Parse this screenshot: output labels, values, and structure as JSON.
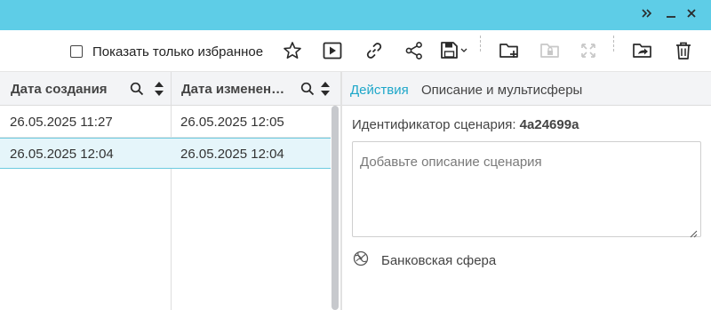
{
  "window": {
    "icons": {
      "collapse": "double-chevron-right-icon",
      "minimize": "minimize-icon",
      "close": "close-icon"
    }
  },
  "toolbar": {
    "favorites_label": "Показать только избранное",
    "favorites_checked": false,
    "icons": [
      "star-icon",
      "play-icon",
      "link-icon",
      "share-icon",
      "save-dropdown-icon",
      "add-folder-icon",
      "lock-folder-icon",
      "expand-icon",
      "open-folder-icon",
      "trash-icon"
    ]
  },
  "grid": {
    "columns": [
      {
        "label": "Дата создания"
      },
      {
        "label": "Дата изменен…"
      }
    ],
    "rows": [
      {
        "created": "26.05.2025 11:27",
        "modified": "26.05.2025 12:05",
        "selected": false
      },
      {
        "created": "26.05.2025 12:04",
        "modified": "26.05.2025 12:04",
        "selected": true
      }
    ]
  },
  "details": {
    "tabs": [
      {
        "label": "Действия",
        "active": true
      },
      {
        "label": "Описание и мультисферы",
        "active": false
      }
    ],
    "identifier_label": "Идентификатор сценария:",
    "identifier_value": "4a24699a",
    "description_placeholder": "Добавьте описание сценария",
    "sphere_label": "Банковская сфера"
  },
  "colors": {
    "titlebar": "#5ecde7",
    "accent": "#1ea7c9",
    "selected_row": "#e5f5fa",
    "disabled_icon": "#c8c8c8"
  }
}
